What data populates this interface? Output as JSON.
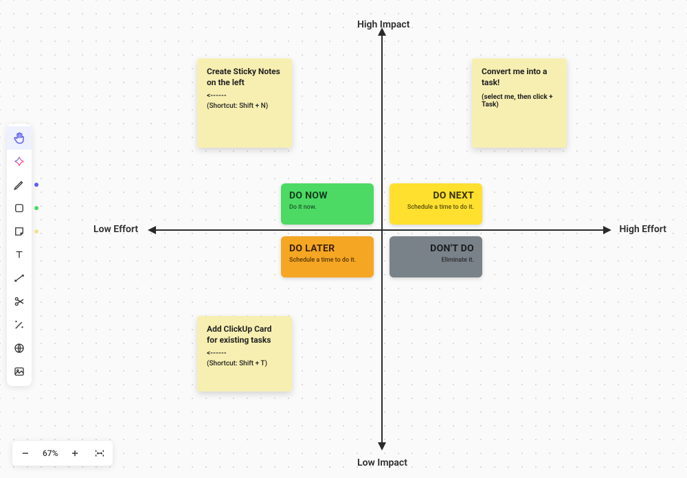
{
  "axes": {
    "top": "High Impact",
    "bottom": "Low Impact",
    "left": "Low Effort",
    "right": "High Effort"
  },
  "quadrants": {
    "do_now": {
      "title": "DO NOW",
      "sub": "Do it now.",
      "bg": "#4CD964",
      "fg": "#143d1d"
    },
    "do_next": {
      "title": "DO NEXT",
      "sub": "Schedule a time to do it.",
      "bg": "#FFE02E",
      "fg": "#3a3200"
    },
    "do_later": {
      "title": "DO LATER",
      "sub": "Schedule a time to do it.",
      "bg": "#F5A623",
      "fg": "#3a2300"
    },
    "dont_do": {
      "title": "DON'T DO",
      "sub": "Eliminate it.",
      "bg": "#7a8289",
      "fg": "#1a1c1e"
    }
  },
  "stickies": {
    "note_left": {
      "title": "Create Sticky Notes on the left",
      "arrow": "<------",
      "shortcut": "(Shortcut: Shift + N)"
    },
    "note_task": {
      "title": "Convert me into a task!",
      "sub": "(select me, then click + Task)"
    },
    "note_card": {
      "title": "Add ClickUp Card for existing tasks",
      "arrow": "<------",
      "shortcut": "(Shortcut: Shift + T)"
    }
  },
  "zoom": {
    "level": "67%"
  },
  "tool_colors": {
    "pen": "#5b5fef",
    "shape": "#4CD964",
    "sticky": "#f3e28d"
  }
}
